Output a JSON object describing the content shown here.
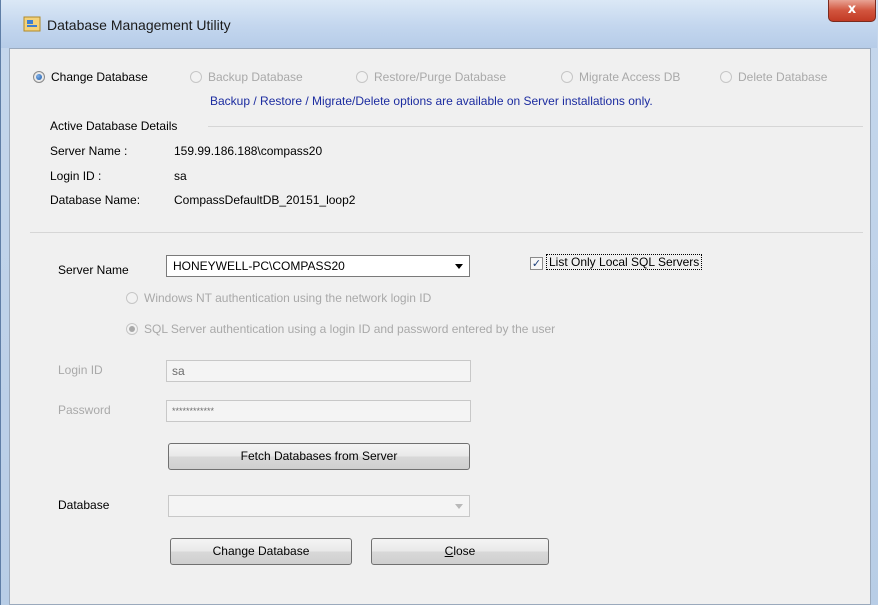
{
  "window": {
    "title": "Database Management Utility",
    "close_label": "x"
  },
  "mode_options": [
    {
      "label": "Change Database",
      "checked": true,
      "enabled": true
    },
    {
      "label": "Backup Database",
      "checked": false,
      "enabled": false
    },
    {
      "label": "Restore/Purge Database",
      "checked": false,
      "enabled": false
    },
    {
      "label": "Migrate Access DB",
      "checked": false,
      "enabled": false
    },
    {
      "label": "Delete Database",
      "checked": false,
      "enabled": false
    }
  ],
  "info_text": "Backup / Restore / Migrate/Delete options are available on Server installations only.",
  "active_details": {
    "title": "Active Database Details",
    "server_label": "Server  Name :",
    "server_value": "159.99.186.188\\compass20",
    "login_label": "Login ID :",
    "login_value": "sa",
    "database_label": "Database  Name:",
    "database_value": "CompassDefaultDB_20151_loop2"
  },
  "form": {
    "server_name_label": "Server Name",
    "server_name_value": "HONEYWELL-PC\\COMPASS20",
    "list_local_label": "List Only Local SQL Servers",
    "list_local_checked": true,
    "auth_windows_label": "Windows NT authentication using the network login ID",
    "auth_sql_label": "SQL Server authentication using a login ID and password entered by the user",
    "login_id_label": "Login ID",
    "login_id_value": "sa",
    "password_label": "Password",
    "password_value": "************",
    "fetch_button": "Fetch Databases from Server",
    "database_label": "Database",
    "database_value": "",
    "change_button": "Change Database",
    "close_button_prefix": "C",
    "close_button_rest": "lose"
  },
  "colors": {
    "info_text": "#1c2ca0",
    "title_bar": "#c3d6ee",
    "close_button": "#c23a24"
  }
}
